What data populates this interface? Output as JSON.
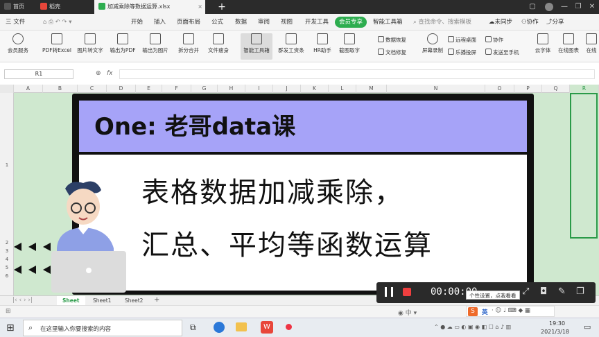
{
  "titlebar": {
    "tabs": [
      {
        "label": "首页",
        "icon": "home-icon"
      },
      {
        "label": "稻壳",
        "icon": "docer-icon"
      },
      {
        "label": "加减乘除等数据运算.xlsx",
        "icon": "spreadsheet-icon"
      }
    ]
  },
  "menubar": {
    "file": "三 文件",
    "items": [
      "开始",
      "插入",
      "页面布局",
      "公式",
      "数据",
      "审阅",
      "视图",
      "开发工具"
    ],
    "vip": "会员专享",
    "smart": "智能工具箱",
    "search_placeholder": "查找命令、搜索模板",
    "sync": "未同步",
    "collab": "协作",
    "share": "分享"
  },
  "ribbon": {
    "big": [
      "会员服务",
      "PDF转Excel",
      "图片转文字",
      "输出为PDF",
      "输出为图片",
      "拆分合并",
      "文件瘦身",
      "智能工具箱",
      "群发工资条",
      "HR助手",
      "截图取字"
    ],
    "small": [
      "数据恢复",
      "文档修复",
      "屏幕录制",
      "远程桌面",
      "乐播投屏",
      "协作",
      "发送至手机",
      "云字体",
      "在线图表",
      "在线"
    ]
  },
  "formula": {
    "cell_ref": "R1",
    "fx": "fx"
  },
  "columns": [
    "A",
    "B",
    "C",
    "D",
    "E",
    "F",
    "G",
    "H",
    "I",
    "J",
    "K",
    "L",
    "M",
    "N",
    "O",
    "P",
    "Q",
    "R"
  ],
  "rows": [
    "1",
    "2",
    "3",
    "4",
    "5",
    "6"
  ],
  "slide": {
    "brand": "One: 老哥data课",
    "line1": "表格数据加减乘除，",
    "line2": "汇总、平均等函数运算"
  },
  "sheets": [
    "Sheet",
    "Sheet1",
    "Sheet2"
  ],
  "recorder": {
    "time": "00:00:00",
    "tooltip": "个性设置，点我看看"
  },
  "taskbar": {
    "search_placeholder": "在这里输入你要搜索的内容",
    "ime": "英",
    "time": "19:30",
    "date": "2021/3/18"
  },
  "colors": {
    "accent": "#2dad4f",
    "slide_header": "#a6a3f8",
    "sheet_bg": "#cfe8cf"
  }
}
